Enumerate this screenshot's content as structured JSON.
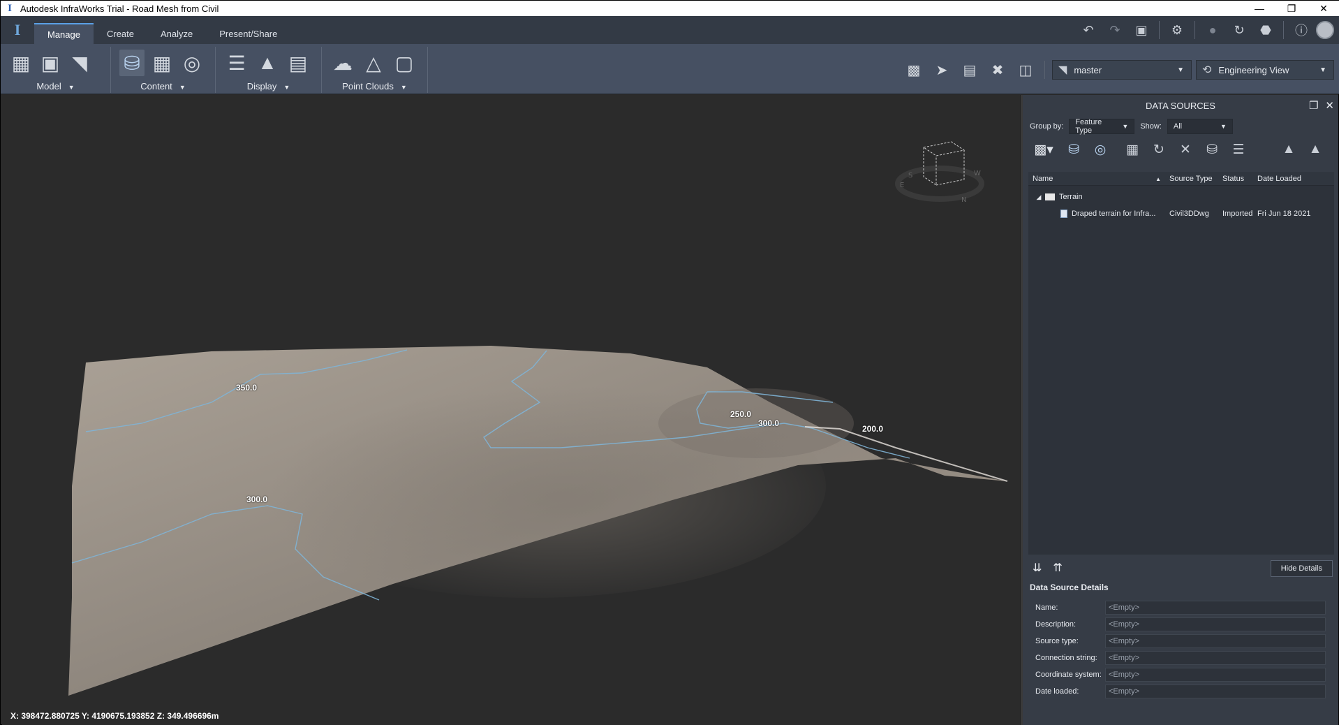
{
  "window": {
    "title": "Autodesk InfraWorks Trial - Road Mesh from Civil",
    "app_icon_glyph": "I"
  },
  "ribbon_tabs": [
    {
      "label": "Manage",
      "active": true
    },
    {
      "label": "Create",
      "active": false
    },
    {
      "label": "Analyze",
      "active": false
    },
    {
      "label": "Present/Share",
      "active": false
    }
  ],
  "ribbon_panels": [
    {
      "label": "Model"
    },
    {
      "label": "Content"
    },
    {
      "label": "Display"
    },
    {
      "label": "Point Clouds"
    }
  ],
  "proposal_dropdown": {
    "value": "master"
  },
  "view_dropdown": {
    "value": "Engineering View"
  },
  "viewport": {
    "contour_labels": [
      "350.0",
      "300.0",
      "250.0",
      "300.0",
      "200.0"
    ],
    "coordinates": "X: 398472.880725 Y: 4190675.193852 Z: 349.496696m",
    "navcube_letters": {
      "e": "E",
      "s": "S",
      "n": "N",
      "w": "W"
    }
  },
  "data_sources": {
    "title": "DATA SOURCES",
    "group_by_label": "Group by:",
    "group_by_value": "Feature Type",
    "show_label": "Show:",
    "show_value": "All",
    "columns": {
      "name": "Name",
      "source_type": "Source Type",
      "status": "Status",
      "date_loaded": "Date Loaded"
    },
    "tree": {
      "folder": "Terrain",
      "items": [
        {
          "name": "Draped  terrain for Infra...",
          "source_type": "Civil3DDwg",
          "status": "Imported",
          "date_loaded": "Fri Jun 18 2021"
        }
      ]
    },
    "hide_details_label": "Hide Details",
    "details_title": "Data Source Details",
    "details": [
      {
        "label": "Name:",
        "value": "<Empty>"
      },
      {
        "label": "Description:",
        "value": "<Empty>"
      },
      {
        "label": "Source type:",
        "value": "<Empty>"
      },
      {
        "label": "Connection string:",
        "value": "<Empty>"
      },
      {
        "label": "Coordinate system:",
        "value": "<Empty>"
      },
      {
        "label": "Date loaded:",
        "value": "<Empty>"
      }
    ]
  },
  "colors": {
    "accent": "#5aa0e6",
    "ribbon": "#465062",
    "panel": "#363c46",
    "terrain": "#a39a90",
    "contour": "#7fb4d6"
  }
}
